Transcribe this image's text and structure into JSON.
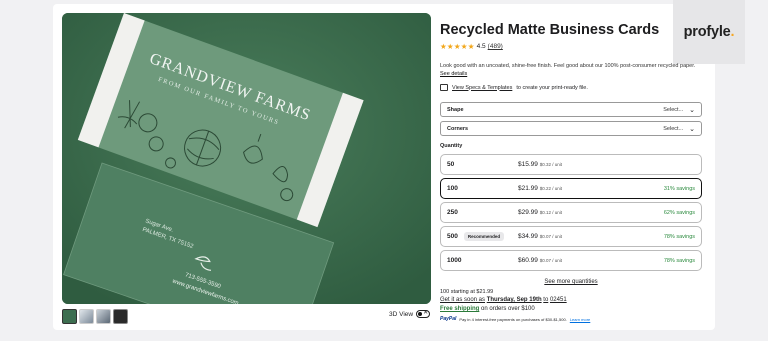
{
  "product": {
    "title": "Recycled Matte Business Cards",
    "rating_stars": "★★★★★",
    "rating_value": "4.5",
    "review_count": "(489)",
    "description": "Look good with an uncoated, shine-free finish. Feel good about our 100% post-consumer recycled paper.",
    "details_link": "See details",
    "specs_link": "View Specs & Templates",
    "specs_suffix": "to create your print-ready file."
  },
  "card_art": {
    "brand": "GRANDVIEW FARMS",
    "tagline": "FROM OUR FAMILY TO YOURS",
    "address_1": "Sugar Ave.",
    "address_2": "PALMER, TX 75152",
    "phone": "713-555-3590",
    "website": "www.grandviewfarms.com"
  },
  "options": {
    "shape_label": "Shape",
    "shape_value": "Select...",
    "corners_label": "Corners",
    "corners_value": "Select..."
  },
  "quantity": {
    "label": "Quantity",
    "rows": [
      {
        "qty": "50",
        "price": "$15.99",
        "unit": "$0.32 / unit",
        "badge": "",
        "savings": ""
      },
      {
        "qty": "100",
        "price": "$21.99",
        "unit": "$0.22 / unit",
        "badge": "",
        "savings": "31% savings"
      },
      {
        "qty": "250",
        "price": "$29.99",
        "unit": "$0.12 / unit",
        "badge": "",
        "savings": "62% savings"
      },
      {
        "qty": "500",
        "price": "$34.99",
        "unit": "$0.07 / unit",
        "badge": "Recommended",
        "savings": "78% savings"
      },
      {
        "qty": "1000",
        "price": "$60.99",
        "unit": "$0.07 / unit",
        "badge": "",
        "savings": "78% savings"
      }
    ],
    "more_link": "See more quantities"
  },
  "summary": {
    "starting": "100 starting at $21.99",
    "ship_prefix": "Get it as soon as",
    "ship_date": "Thursday, Sep 19th",
    "ship_to": "to",
    "zip": "02451",
    "free_shipping": "Free shipping",
    "free_suffix": "on orders over $100",
    "paypal_brand": "PayPal",
    "paypal_text": "Pay in 4 interest-free payments on purchases of $30-$1,500.",
    "paypal_link": "Learn more"
  },
  "gallery": {
    "view3d_label": "3D View",
    "toggle_symbol": "✕"
  },
  "brand_logo": {
    "name": "profyle",
    "dot": "."
  },
  "colors": {
    "accent_green": "#2b8a3e",
    "card_green": "#386a4b",
    "star": "#f2a71b"
  },
  "icons": [
    "star-icon",
    "document-icon",
    "chevron-down-icon",
    "paypal-icon"
  ]
}
